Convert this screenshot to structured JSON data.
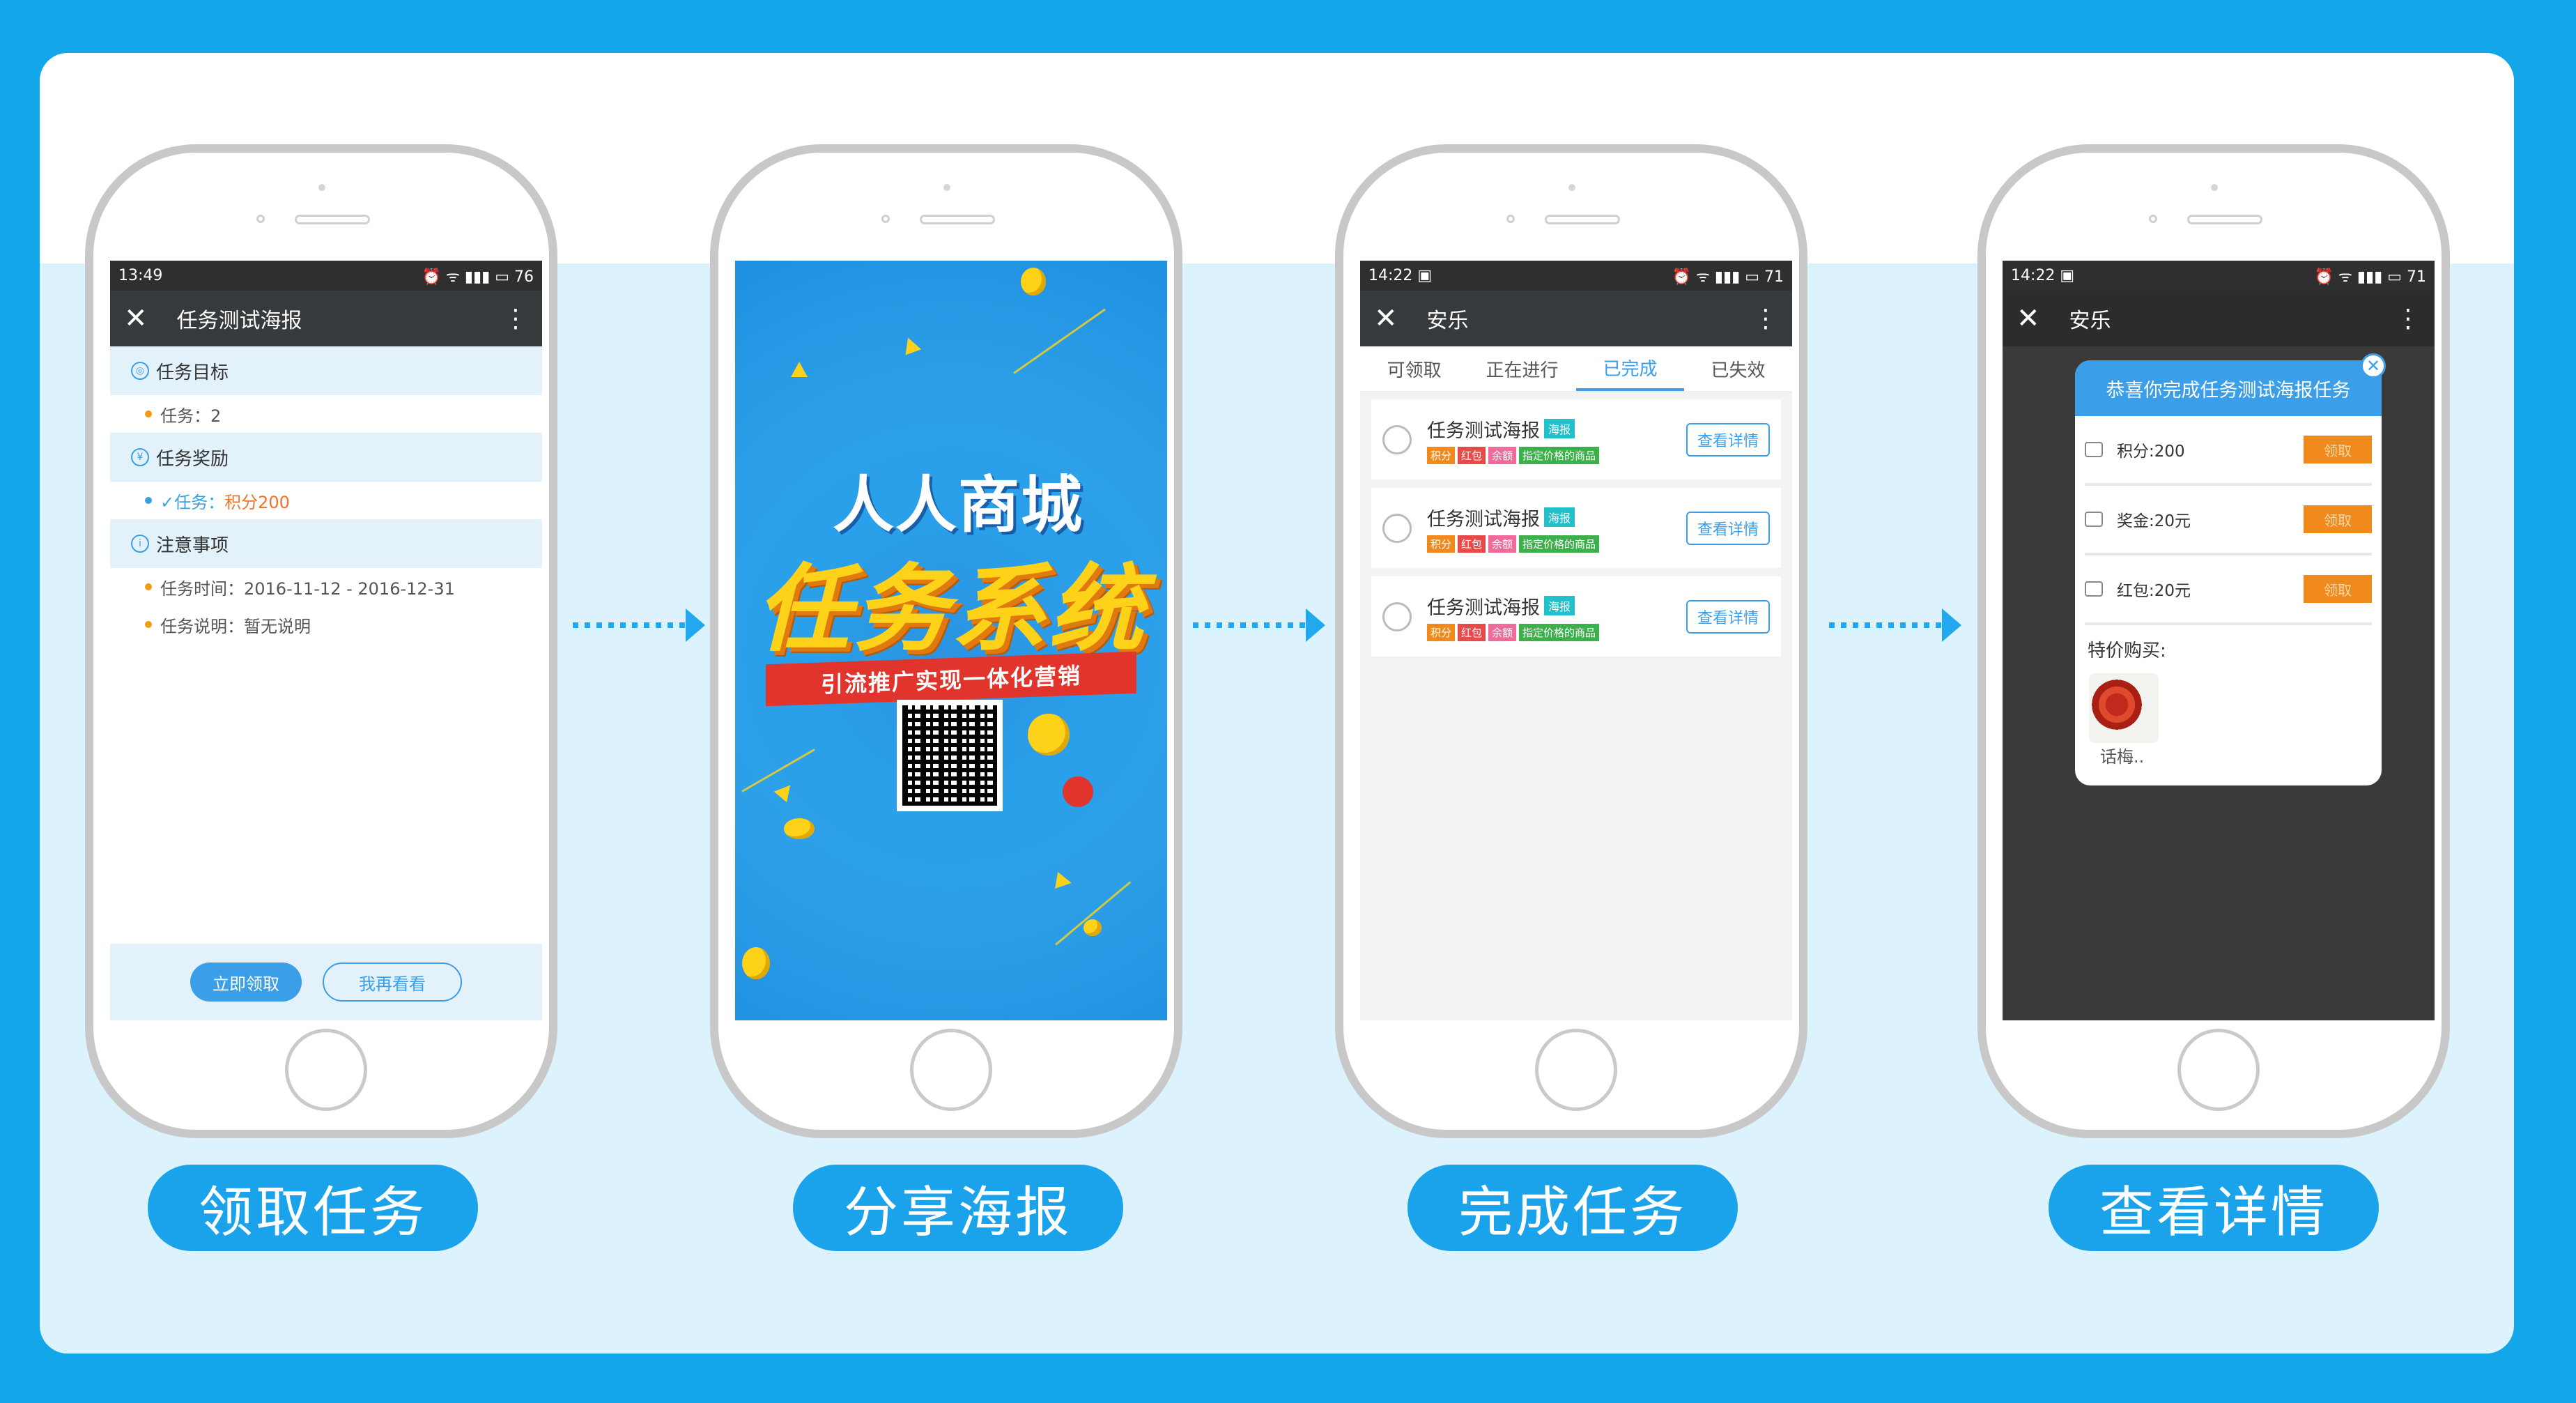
{
  "phone1": {
    "status_time": "13:49",
    "status_battery": "76",
    "title": "任务测试海报",
    "sections": [
      {
        "header": "任务目标",
        "rows": [
          "任务：2"
        ]
      },
      {
        "header": "任务奖励",
        "rows_prefix": "✓任务：",
        "reward": "积分200"
      },
      {
        "header": "注意事项",
        "rows": [
          "任务时间：2016-11-12 - 2016-12-31",
          "任务说明：暂无说明"
        ]
      }
    ],
    "btn_claim": "立即领取",
    "btn_later": "我再看看"
  },
  "phone2": {
    "poster_title1": "人人商城",
    "poster_title2": "任务系统",
    "poster_ribbon": "引流推广实现一体化营销"
  },
  "phone3": {
    "status_time": "14:22",
    "status_battery": "71",
    "title": "安乐",
    "tabs": [
      "可领取",
      "正在进行",
      "已完成",
      "已失效"
    ],
    "items": [
      {
        "name": "任务测试海报",
        "tag": "海报",
        "tags": [
          "积分",
          "红包",
          "余额",
          "指定价格的商品"
        ],
        "button": "查看详情"
      },
      {
        "name": "任务测试海报",
        "tag": "海报",
        "tags": [
          "积分",
          "红包",
          "余额",
          "指定价格的商品"
        ],
        "button": "查看详情"
      },
      {
        "name": "任务测试海报",
        "tag": "海报",
        "tags": [
          "积分",
          "红包",
          "余额",
          "指定价格的商品"
        ],
        "button": "查看详情"
      }
    ]
  },
  "phone4": {
    "status_time": "14:22",
    "status_battery": "71",
    "title": "安乐",
    "modal_title": "恭喜你完成任务测试海报任务",
    "rewards": [
      {
        "label": "积分:200",
        "button": "领取"
      },
      {
        "label": "奖金:20元",
        "button": "领取"
      },
      {
        "label": "红包:20元",
        "button": "领取"
      }
    ],
    "special_label": "特价购买:",
    "product_name": "话梅.."
  },
  "labels": [
    "领取任务",
    "分享海报",
    "完成任务",
    "查看详情"
  ],
  "colors": {
    "background": "#13a7ea",
    "accent": "#3a9ee8",
    "pill": "#1aa3ea",
    "orange": "#f08a1c"
  }
}
